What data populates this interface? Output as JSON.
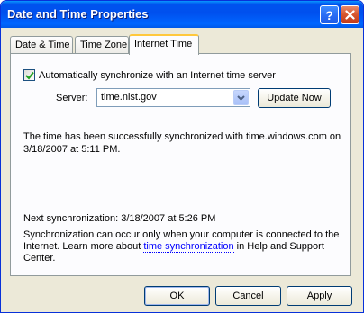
{
  "window": {
    "title": "Date and Time Properties",
    "help_glyph": "?",
    "accent": "#0053ee"
  },
  "tabs": [
    {
      "label": "Date & Time"
    },
    {
      "label": "Time Zone"
    },
    {
      "label": "Internet Time",
      "active": true
    }
  ],
  "internet_time": {
    "auto_sync_label": "Automatically synchronize with an Internet time server",
    "auto_sync_checked": true,
    "server_label": "Server:",
    "server_value": "time.nist.gov",
    "update_button": "Update Now",
    "status_message": "The time has been successfully synchronized with time.windows.com on 3/18/2007 at 5:11 PM.",
    "next_sync": "Next synchronization: 3/18/2007 at 5:26 PM",
    "info_before": "Synchronization can occur only when your computer is connected to the Internet.  Learn more about ",
    "info_link": "time synchronization",
    "info_after": " in Help and Support Center."
  },
  "footer": {
    "ok": "OK",
    "cancel": "Cancel",
    "apply": "Apply"
  }
}
